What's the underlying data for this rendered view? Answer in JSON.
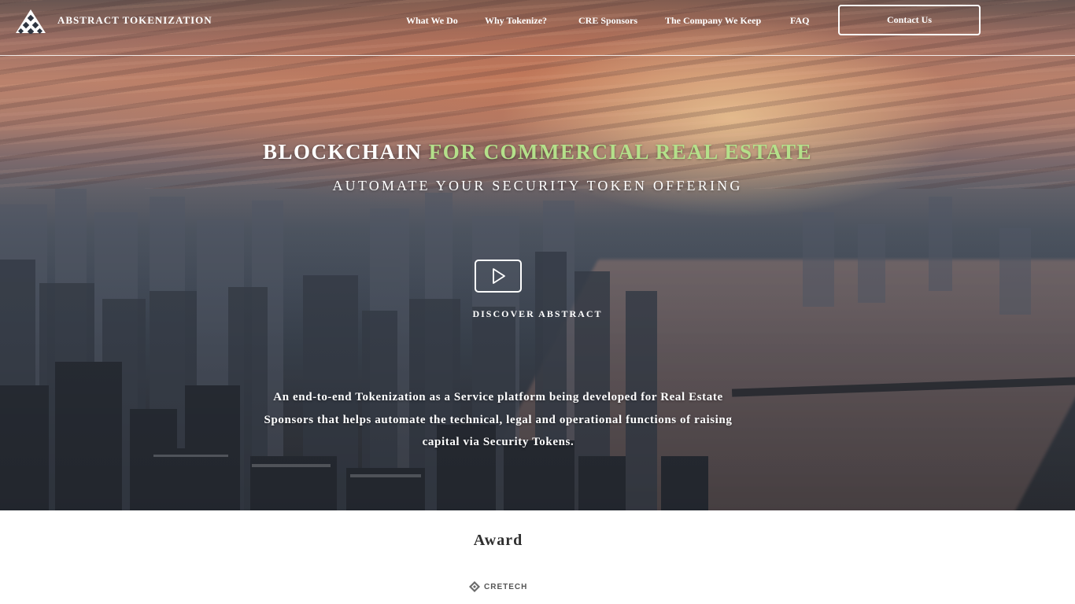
{
  "nav": {
    "brand": "ABSTRACT TOKENIZATION",
    "links": [
      "What We Do",
      "Why Tokenize?",
      "CRE Sponsors",
      "The Company We Keep",
      "FAQ"
    ],
    "contact_label": "Contact Us"
  },
  "hero": {
    "headline_white": "BLOCKCHAIN",
    "headline_accent": "FOR COMMERCIAL REAL ESTATE",
    "subheadline": "AUTOMATE YOUR SECURITY TOKEN OFFERING",
    "discover_label": "DISCOVER ABSTRACT",
    "description": "An end-to-end Tokenization as a Service platform being developed for Real Estate Sponsors that helps automate the technical, legal and operational functions of raising capital via Security Tokens."
  },
  "award": {
    "title": "Award",
    "logo_text": "CRETECH"
  },
  "colors": {
    "accent": "#b4e08a",
    "text_on_hero": "#ffffff",
    "award_title": "#2f2f2f"
  },
  "icons": {
    "brand_logo": "abstract-triangle-logo",
    "play": "play-icon",
    "cretech_logo": "cretech-diamond-logo"
  }
}
